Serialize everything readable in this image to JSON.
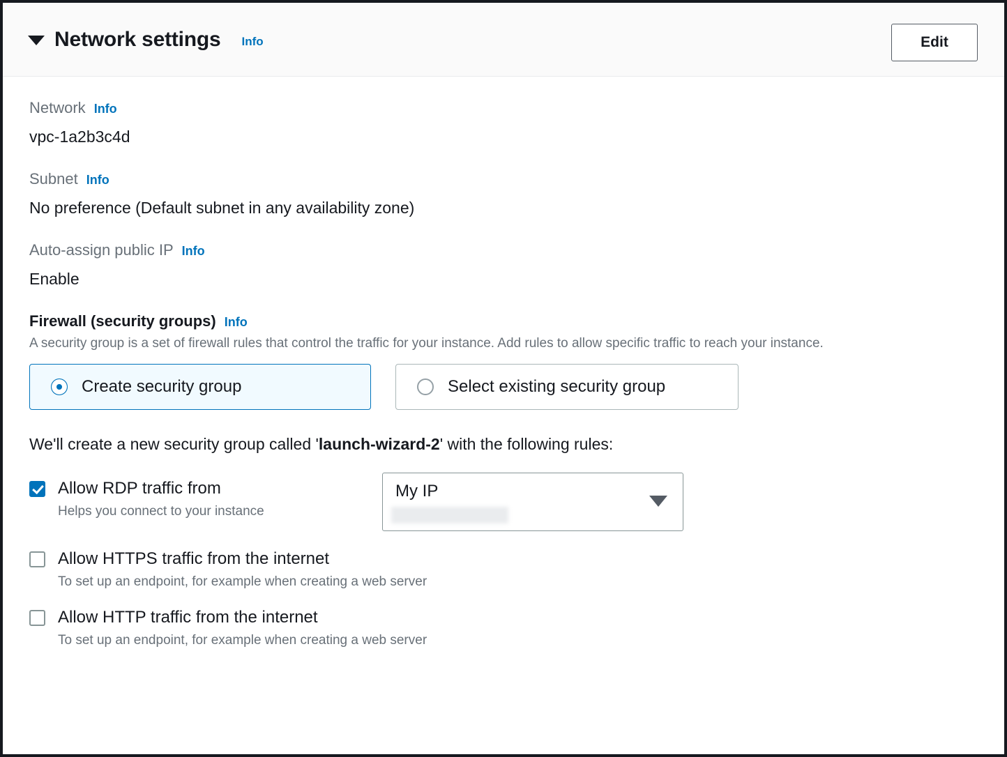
{
  "header": {
    "title": "Network settings",
    "info_label": "Info",
    "edit_label": "Edit",
    "disclosure_state": "expanded"
  },
  "fields": [
    {
      "label": "Network",
      "info_label": "Info",
      "value": "vpc-1a2b3c4d"
    },
    {
      "label": "Subnet",
      "info_label": "Info",
      "value": "No preference (Default subnet in any availability zone)"
    },
    {
      "label": "Auto-assign public IP",
      "info_label": "Info",
      "value": "Enable"
    }
  ],
  "firewall": {
    "heading": "Firewall (security groups)",
    "info_label": "Info",
    "description": "A security group is a set of firewall rules that control the traffic for your instance. Add rules to allow specific traffic to reach your instance.",
    "options": [
      {
        "label": "Create security group",
        "selected": true
      },
      {
        "label": "Select existing security group",
        "selected": false
      }
    ],
    "sentence": {
      "prefix": "We'll create a new security group called '",
      "group_name": "launch-wizard-2",
      "suffix": "' with the following rules:"
    },
    "rules": [
      {
        "label": "Allow RDP traffic from",
        "sublabel": "Helps you connect to your instance",
        "checked": true,
        "source_dropdown": {
          "value": "My IP",
          "secondary_value_redacted": true
        }
      },
      {
        "label": "Allow HTTPS traffic from the internet",
        "sublabel": "To set up an endpoint, for example when creating a web server",
        "checked": false
      },
      {
        "label": "Allow HTTP traffic from the internet",
        "sublabel": "To set up an endpoint, for example when creating a web server",
        "checked": false
      }
    ]
  },
  "colors": {
    "accent": "#0073bb",
    "selected_card_bg": "#f1faff",
    "label_grey": "#687078",
    "text_dark": "#16191f",
    "panel_border": "#16191f",
    "header_bg": "#fafafa"
  }
}
